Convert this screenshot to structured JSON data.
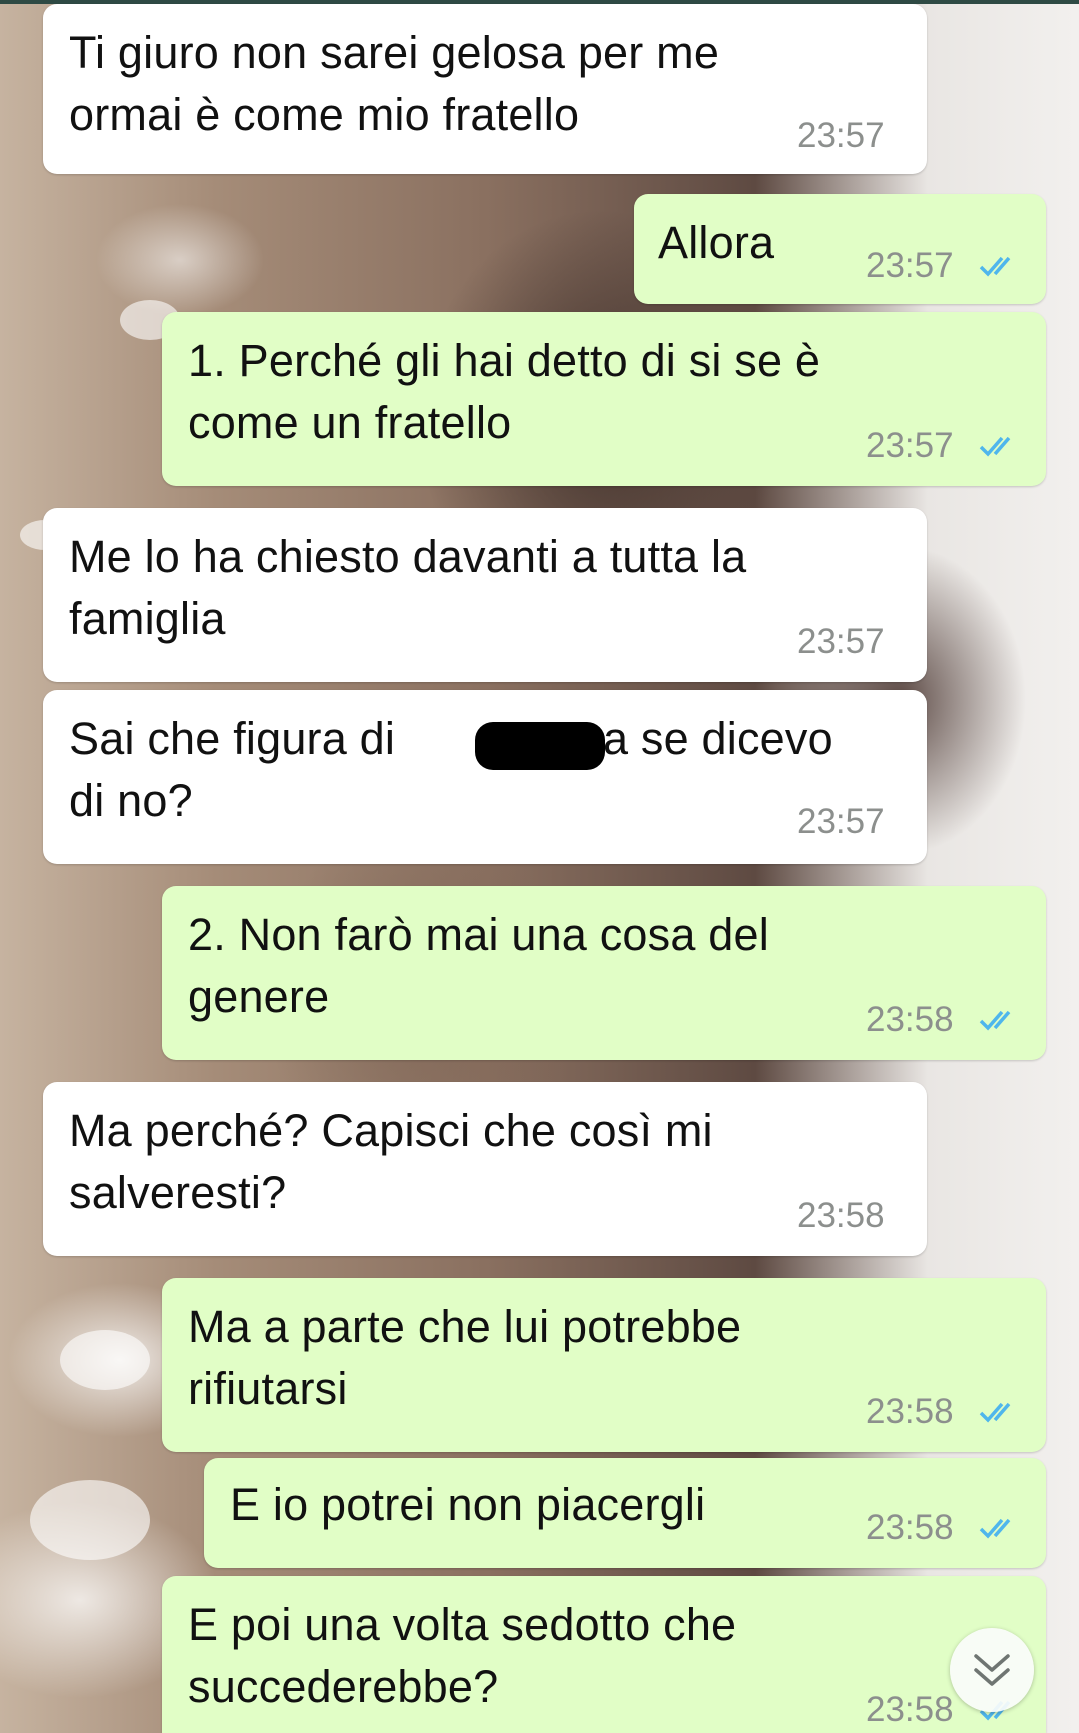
{
  "colors": {
    "incoming_bubble": "#ffffff",
    "outgoing_bubble": "#e1fec6",
    "timestamp": "#8c8f8d",
    "read_ticks": "#4fb6ec"
  },
  "messages": [
    {
      "direction": "in",
      "lines": [
        "Ti giuro non sarei gelosa per me",
        "ormai è come mio fratello"
      ],
      "time": "23:57"
    },
    {
      "direction": "out",
      "lines": [
        "Allora"
      ],
      "time": "23:57",
      "status_icon": "double-check-read"
    },
    {
      "direction": "out",
      "lines": [
        "1. Perché gli hai detto di si se è",
        "come un fratello"
      ],
      "time": "23:57",
      "status_icon": "double-check-read"
    },
    {
      "direction": "in",
      "lines": [
        "Me lo ha chiesto davanti a tutta la",
        "famiglia"
      ],
      "time": "23:57"
    },
    {
      "direction": "in",
      "lines": [
        "Sai che figura di ",
        "a se dicevo",
        "di no?"
      ],
      "time": "23:57",
      "redacted": true
    },
    {
      "direction": "out",
      "lines": [
        "2. Non farò mai una cosa del",
        "genere"
      ],
      "time": "23:58",
      "status_icon": "double-check-read"
    },
    {
      "direction": "in",
      "lines": [
        "Ma perché? Capisci che così mi",
        "salveresti?"
      ],
      "time": "23:58"
    },
    {
      "direction": "out",
      "lines": [
        "Ma a parte che lui potrebbe",
        "rifiutarsi"
      ],
      "time": "23:58",
      "status_icon": "double-check-read"
    },
    {
      "direction": "out",
      "lines": [
        "E io potrei non piacergli"
      ],
      "time": "23:58",
      "status_icon": "double-check-read"
    },
    {
      "direction": "out",
      "lines": [
        "E poi una volta sedotto che",
        "succederebbe?"
      ],
      "time": "23:58",
      "status_icon": "double-check-read"
    }
  ],
  "scroll_button": {
    "icon": "double-chevron-down-icon"
  }
}
